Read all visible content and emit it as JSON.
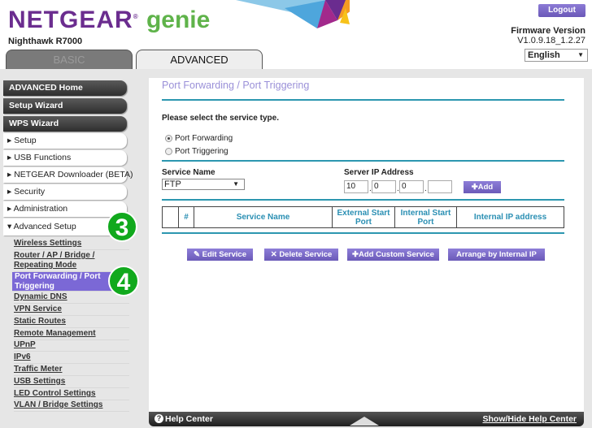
{
  "header": {
    "logo": "NETGEAR genie",
    "logo_main": "NETGEAR",
    "logo_genie": "genie",
    "model": "Nighthawk R7000",
    "logout": "Logout",
    "firmware_label": "Firmware Version",
    "firmware_version": "V1.0.9.18_1.2.27",
    "language": "English",
    "tabs": [
      {
        "label": "BASIC",
        "active": false
      },
      {
        "label": "ADVANCED",
        "active": true
      }
    ]
  },
  "sidebar": {
    "dark_items": [
      "ADVANCED Home",
      "Setup Wizard",
      "WPS Wizard"
    ],
    "menu_items": [
      "▸ Setup",
      "▸ USB Functions",
      "▸ NETGEAR Downloader (BETA)",
      "▸ Security",
      "▸ Administration",
      "▾ Advanced Setup"
    ],
    "sub_items": [
      "Wireless Settings",
      "Router / AP / Bridge / Repeating Mode",
      "Port Forwarding / Port Triggering",
      "Dynamic DNS",
      "VPN Service",
      "Static Routes",
      "Remote Management",
      "UPnP",
      "IPv6",
      "Traffic Meter",
      "USB Settings",
      "LED Control Settings",
      "VLAN / Bridge Settings"
    ],
    "active_sub": "Port Forwarding / Port Triggering",
    "step_badges": [
      "3",
      "4"
    ]
  },
  "main": {
    "title": "Port Forwarding / Port Triggering",
    "prompt": "Please select the service type.",
    "radios": [
      {
        "label": "Port Forwarding",
        "checked": true
      },
      {
        "label": "Port Triggering",
        "checked": false
      }
    ],
    "service_name_label": "Service Name",
    "service_name_value": "FTP",
    "server_ip_label": "Server IP Address",
    "server_ip": [
      "10",
      "0",
      "0",
      ""
    ],
    "add_button": "Add",
    "table_headers": [
      "",
      "#",
      "Service Name",
      "External Start Port",
      "Internal Start Port",
      "Internal IP address"
    ],
    "buttons": [
      "Edit Service",
      "Delete Service",
      "Add Custom Service",
      "Arrange by Internal IP"
    ]
  },
  "footer": {
    "help_center": "Help Center",
    "toggle": "Show/Hide Help Center"
  },
  "colors": {
    "brand_purple": "#6b2d8f",
    "genie_green": "#5fb34a",
    "accent_teal": "#2c97b0",
    "button_purple": "#7b68d6",
    "badge_green": "#11a91d"
  }
}
